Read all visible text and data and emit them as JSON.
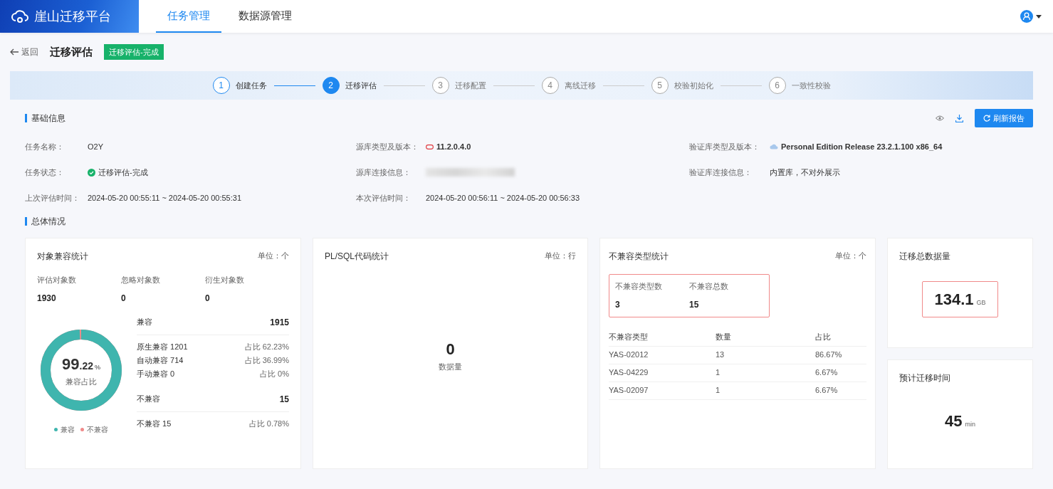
{
  "brand": {
    "title": "崖山迁移平台"
  },
  "nav": [
    {
      "label": "任务管理",
      "selected": true
    },
    {
      "label": "数据源管理",
      "selected": false
    }
  ],
  "header": {
    "back": "返回",
    "title": "迁移评估",
    "status_tag": "迁移评估-完成"
  },
  "steps": [
    {
      "number": "1",
      "label": "创建任务",
      "done": true,
      "selected": false
    },
    {
      "number": "2",
      "label": "迁移评估",
      "done": false,
      "selected": true
    },
    {
      "number": "3",
      "label": "迁移配置",
      "done": false,
      "selected": false
    },
    {
      "number": "4",
      "label": "离线迁移",
      "done": false,
      "selected": false
    },
    {
      "number": "5",
      "label": "校验初始化",
      "done": false,
      "selected": false
    },
    {
      "number": "6",
      "label": "一致性校验",
      "done": false,
      "selected": false
    }
  ],
  "basic_info": {
    "title": "基础信息",
    "refresh_button": "刷新报告",
    "rows": [
      [
        {
          "label": "任务名称：",
          "value": "O2Y",
          "kind": "text"
        },
        {
          "label": "源库类型及版本：",
          "value": "11.2.0.4.0",
          "kind": "oracle"
        },
        {
          "label": "验证库类型及版本：",
          "value": "Personal Edition Release 23.2.1.100 x86_64",
          "kind": "cloud"
        }
      ],
      [
        {
          "label": "任务状态：",
          "value": "迁移评估-完成",
          "kind": "status"
        },
        {
          "label": "源库连接信息：",
          "kind": "blurred"
        },
        {
          "label": "验证库连接信息：",
          "value": "内置库，不对外展示",
          "kind": "text"
        }
      ],
      [
        {
          "label": "上次评估时间：",
          "value": "2024-05-20 00:55:11 ~ 2024-05-20 00:55:31",
          "kind": "text"
        },
        {
          "label": "本次评估时间：",
          "value": "2024-05-20 00:56:11 ~ 2024-05-20 00:56:33",
          "kind": "text"
        }
      ]
    ]
  },
  "overview": {
    "title": "总体情况"
  },
  "object_stats": {
    "title": "对象兼容统计",
    "unit": "单位：个",
    "counts": [
      {
        "label": "评估对象数",
        "value": "1930"
      },
      {
        "label": "忽略对象数",
        "value": "0"
      },
      {
        "label": "衍生对象数",
        "value": "0"
      }
    ],
    "donut": {
      "level": 0.9922,
      "value_int": "99",
      "value_dec": ".22",
      "percent": "%",
      "caption": "兼容占比"
    },
    "legend": [
      {
        "label": "兼容",
        "color": "#3fb5ae"
      },
      {
        "label": "不兼容",
        "color": "#f08a8a"
      }
    ],
    "groups": [
      {
        "label": "兼容",
        "total": "1915",
        "rows": [
          {
            "label": "原生兼容 1201",
            "ratio": "占比 62.23%"
          },
          {
            "label": "自动兼容 714",
            "ratio": "占比 36.99%"
          },
          {
            "label": "手动兼容 0",
            "ratio": "占比 0%"
          }
        ]
      },
      {
        "label": "不兼容",
        "total": "15",
        "rows": [
          {
            "label": "不兼容 15",
            "ratio": "占比 0.78%"
          }
        ]
      }
    ]
  },
  "plsql_stats": {
    "title": "PL/SQL代码统计",
    "unit": "单位：行",
    "value": "0",
    "caption": "数据量"
  },
  "incompat_stats": {
    "title": "不兼容类型统计",
    "unit": "单位：个",
    "summary": [
      {
        "label": "不兼容类型数",
        "value": "3"
      },
      {
        "label": "不兼容总数",
        "value": "15"
      }
    ],
    "columns": [
      "不兼容类型",
      "数量",
      "占比"
    ],
    "rows": [
      [
        "YAS-02012",
        "13",
        "86.67%"
      ],
      [
        "YAS-04229",
        "1",
        "6.67%"
      ],
      [
        "YAS-02097",
        "1",
        "6.67%"
      ]
    ]
  },
  "total_data": {
    "title": "迁移总数据量",
    "value": "134.1",
    "unit": "GB"
  },
  "estimated_time": {
    "title": "预计迁移时间",
    "value": "45",
    "unit": "min"
  }
}
